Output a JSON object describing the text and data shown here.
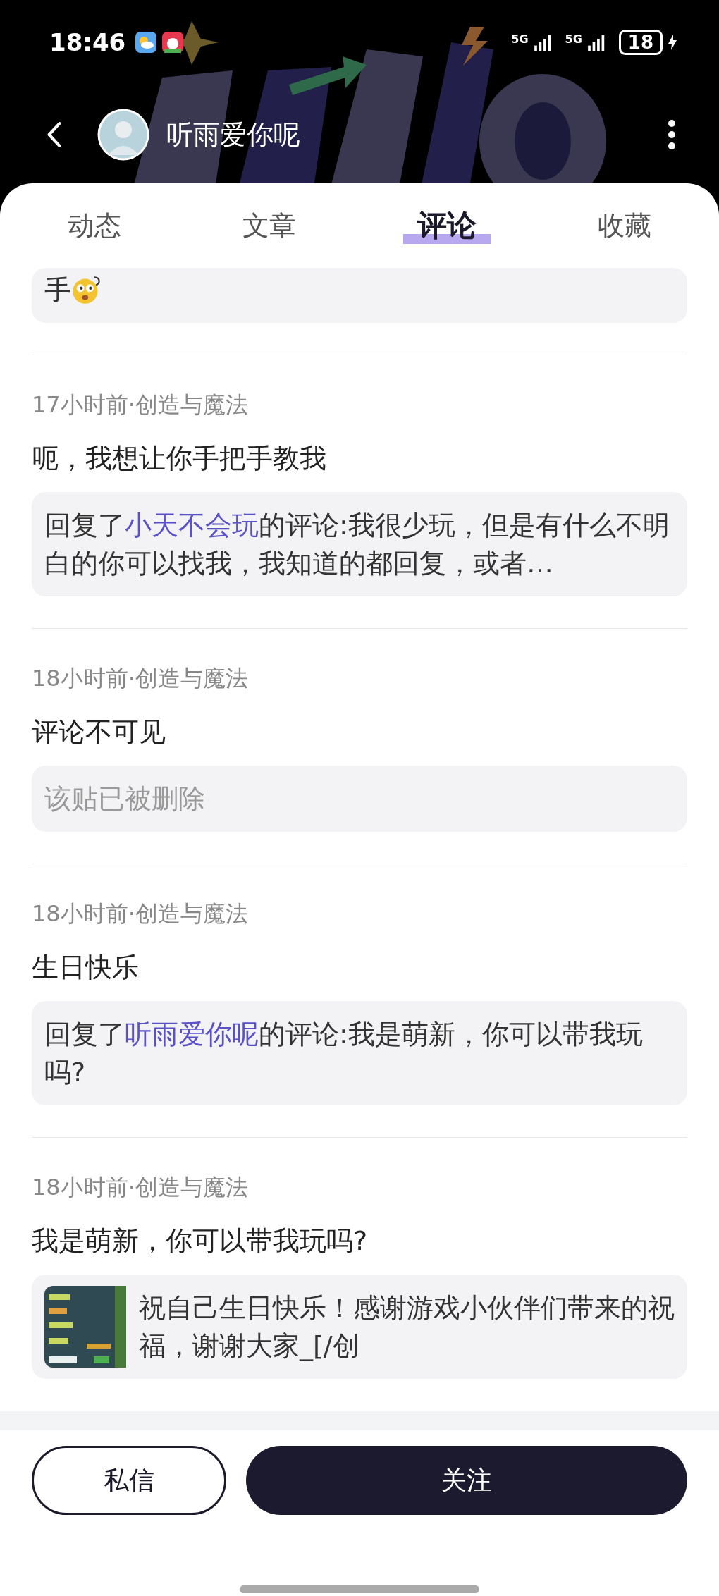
{
  "status_bar": {
    "time": "18:46",
    "signals": [
      "5G",
      "5G"
    ],
    "battery": "18"
  },
  "header": {
    "username": "听雨爱你呢"
  },
  "tabs": [
    {
      "label": "动态",
      "selected": false
    },
    {
      "label": "文章",
      "selected": false
    },
    {
      "label": "评论",
      "selected": true
    },
    {
      "label": "收藏",
      "selected": false
    }
  ],
  "partial_quote": {
    "text": "手"
  },
  "comments": [
    {
      "meta": "17小时前·创造与魔法",
      "text": "呃，我想让你手把手教我",
      "quote": {
        "kind": "reply",
        "prefix": "回复了",
        "user": "小天不会玩",
        "suffix": "的评论:我很少玩，但是有什么不明白的你可以找我，我知道的都回复，或者…"
      }
    },
    {
      "meta": "18小时前·创造与魔法",
      "text": "评论不可见",
      "quote": {
        "kind": "deleted",
        "text": "该贴已被删除"
      }
    },
    {
      "meta": "18小时前·创造与魔法",
      "text": "生日快乐",
      "quote": {
        "kind": "reply",
        "prefix": "回复了",
        "user": "听雨爱你呢",
        "suffix": "的评论:我是萌新，你可以带我玩吗?"
      }
    },
    {
      "meta": "18小时前·创造与魔法",
      "text": "我是萌新，你可以带我玩吗?",
      "quote": {
        "kind": "post",
        "text": "祝自己生日快乐！感谢游戏小伙伴们带来的祝福，谢谢大家_[/创"
      }
    }
  ],
  "buttons": {
    "message": "私信",
    "follow": "关注"
  }
}
